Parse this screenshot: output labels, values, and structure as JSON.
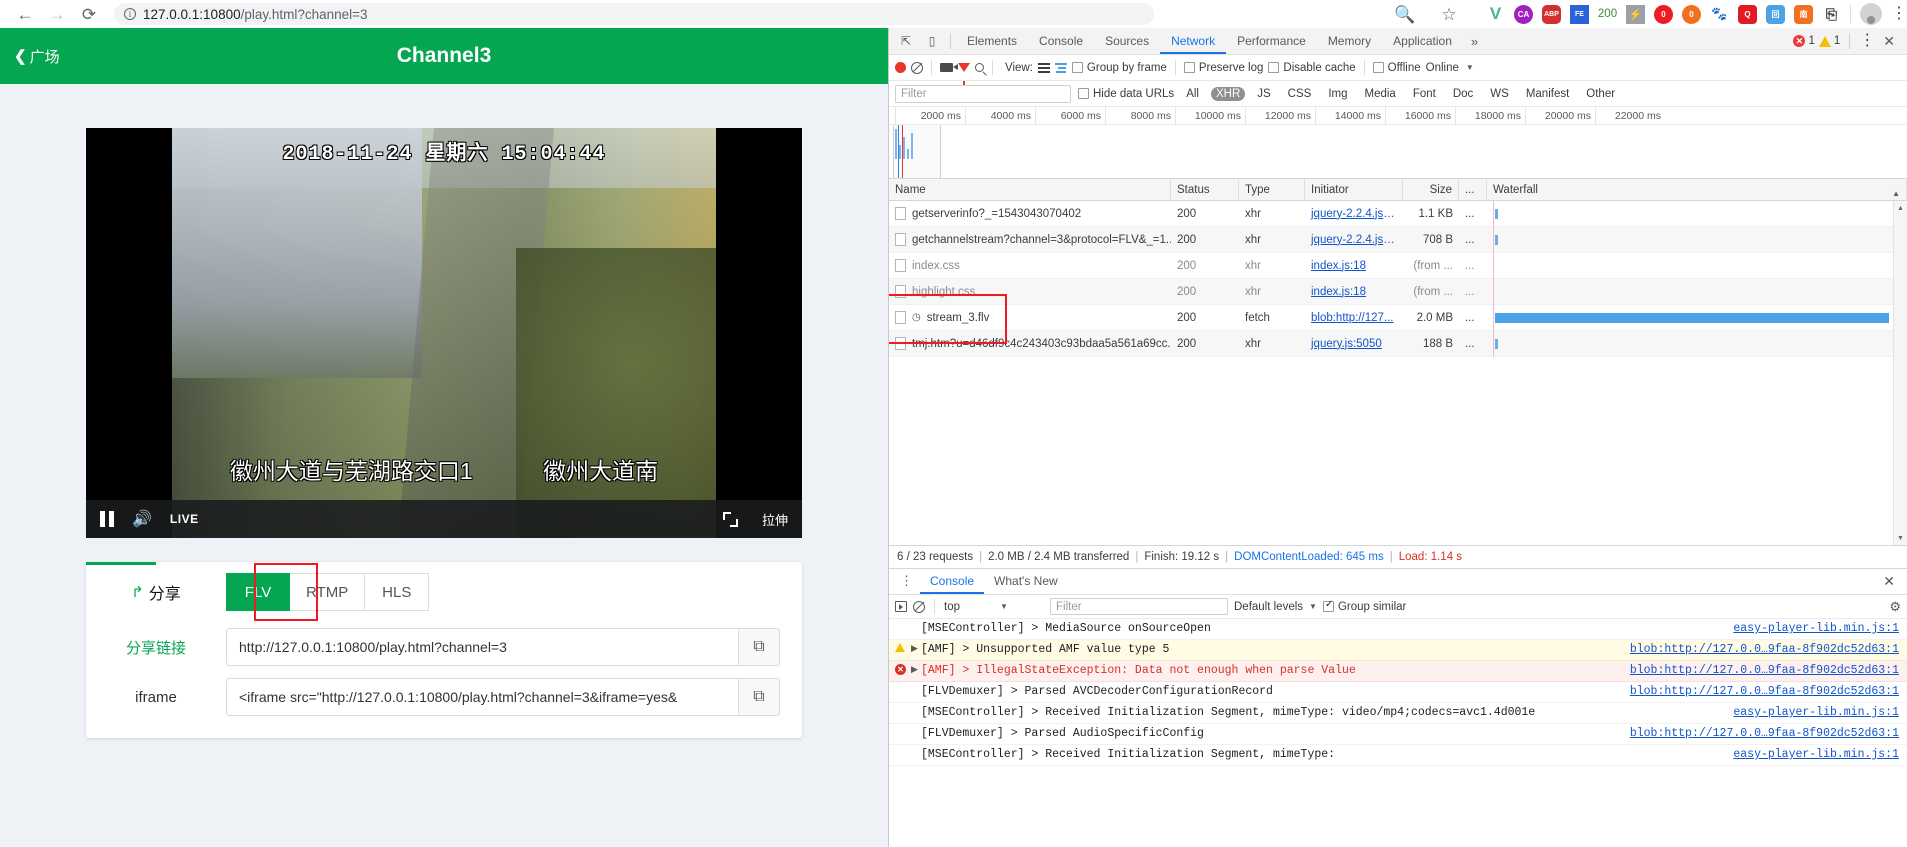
{
  "browser": {
    "back_icon": "back-arrow-icon",
    "forward_icon": "forward-arrow-icon",
    "reload_icon": "reload-icon",
    "info_icon": "info-circle-icon",
    "url_host": "127.0.0.1:10800",
    "url_path": "/play.html?channel=3",
    "zoom_icon": "zoom-search-icon",
    "bookmark_icon": "star-icon",
    "extensions": [
      {
        "name": "vue-devtools-icon",
        "label": "V"
      },
      {
        "name": "colorzilla-icon",
        "label": "CA"
      },
      {
        "name": "adblock-plus-icon",
        "label": "ABP"
      },
      {
        "name": "fehelper-icon",
        "label": "FE"
      },
      {
        "name": "http-status-icon",
        "label": "200"
      },
      {
        "name": "lightning-icon",
        "label": "⚡"
      },
      {
        "name": "octagon-red-icon",
        "label": "()"
      },
      {
        "name": "octagon-orange-icon",
        "label": "()"
      },
      {
        "name": "cat-icon",
        "label": "🐱"
      },
      {
        "name": "qq-red-icon",
        "label": "Q"
      },
      {
        "name": "blue-app-icon",
        "label": "回"
      },
      {
        "name": "orange-app-icon",
        "label": "南"
      },
      {
        "name": "doc-search-icon",
        "label": "⎘"
      }
    ],
    "avatar_icon": "profile-avatar-icon",
    "menu_icon": "chrome-menu-icon"
  },
  "page": {
    "header": {
      "back_label": "广场",
      "title": "Channel3"
    },
    "video": {
      "osd_date": "2018-11-24",
      "osd_weekday": "星期六",
      "osd_time": "15:04:44",
      "caption_1": "徽州大道与芜湖路交口1",
      "caption_2": "徽州大道南",
      "pause_icon": "pause-icon",
      "volume_icon": "volume-icon",
      "live_label": "LIVE",
      "fullscreen_icon": "fullscreen-icon",
      "stretch_label": "拉伸"
    },
    "share": {
      "share_icon": "share-arrow-icon",
      "share_label": "分享",
      "tabs": [
        {
          "label": "FLV",
          "active": true
        },
        {
          "label": "RTMP",
          "active": false
        },
        {
          "label": "HLS",
          "active": false
        }
      ],
      "fields": [
        {
          "label": "分享链接",
          "value": "http://127.0.0.1:10800/play.html?channel=3",
          "copy_icon": "copy-icon"
        },
        {
          "label": "iframe",
          "value": "<iframe src=\"http://127.0.0.1:10800/play.html?channel=3&iframe=yes&",
          "copy_icon": "copy-icon"
        }
      ]
    }
  },
  "devtools": {
    "inspect_icon": "inspect-element-icon",
    "device_icon": "device-toolbar-icon",
    "tabs": [
      {
        "label": "Elements",
        "active": false
      },
      {
        "label": "Console",
        "active": false
      },
      {
        "label": "Sources",
        "active": false
      },
      {
        "label": "Network",
        "active": true
      },
      {
        "label": "Performance",
        "active": false
      },
      {
        "label": "Memory",
        "active": false
      },
      {
        "label": "Application",
        "active": false
      }
    ],
    "more_tabs_icon": "chevron-double-right-icon",
    "error_count": "1",
    "warning_count": "1",
    "settings_icon": "devtools-kebab-icon",
    "close_icon": "close-icon",
    "network_toolbar": {
      "record_icon": "record-icon",
      "clear_icon": "clear-icon",
      "screenshot_icon": "camera-icon",
      "filter_icon": "funnel-icon",
      "search_icon": "search-icon",
      "view_label": "View:",
      "list_view_icon": "list-view-icon",
      "waterfall_view_icon": "waterfall-view-icon",
      "group_by_frame": "Group by frame",
      "preserve_log": "Preserve log",
      "disable_cache": "Disable cache",
      "offline": "Offline",
      "throttle_value": "Online"
    },
    "filter_bar": {
      "filter_placeholder": "Filter",
      "hide_data_urls": "Hide data URLs",
      "types": [
        {
          "label": "All",
          "active": false
        },
        {
          "label": "XHR",
          "active": true
        },
        {
          "label": "JS",
          "active": false
        },
        {
          "label": "CSS",
          "active": false
        },
        {
          "label": "Img",
          "active": false
        },
        {
          "label": "Media",
          "active": false
        },
        {
          "label": "Font",
          "active": false
        },
        {
          "label": "Doc",
          "active": false
        },
        {
          "label": "WS",
          "active": false
        },
        {
          "label": "Manifest",
          "active": false
        },
        {
          "label": "Other",
          "active": false
        }
      ]
    },
    "timeline_ticks": [
      "2000 ms",
      "4000 ms",
      "6000 ms",
      "8000 ms",
      "10000 ms",
      "12000 ms",
      "14000 ms",
      "16000 ms",
      "18000 ms",
      "20000 ms",
      "22000 ms"
    ],
    "table": {
      "columns": [
        "Name",
        "Status",
        "Type",
        "Initiator",
        "Size",
        "...",
        "Waterfall"
      ],
      "rows": [
        {
          "name": "getserverinfo?_=1543043070402",
          "status": "200",
          "type": "xhr",
          "initiator": "jquery-2.2.4.js:9...",
          "size": "1.1 KB",
          "dots": "...",
          "dim": false,
          "icon": null,
          "bar": "small"
        },
        {
          "name": "getchannelstream?channel=3&protocol=FLV&_=1...",
          "status": "200",
          "type": "xhr",
          "initiator": "jquery-2.2.4.js:9...",
          "size": "708 B",
          "dots": "...",
          "dim": false,
          "icon": null,
          "bar": "small"
        },
        {
          "name": "index.css",
          "status": "200",
          "type": "xhr",
          "initiator": "index.js:18",
          "size": "(from ...",
          "dots": "...",
          "dim": true,
          "icon": null,
          "bar": "none"
        },
        {
          "name": "highlight.css",
          "status": "200",
          "type": "xhr",
          "initiator": "index.js:18",
          "size": "(from ...",
          "dots": "...",
          "dim": true,
          "icon": null,
          "bar": "none"
        },
        {
          "name": "stream_3.flv",
          "status": "200",
          "type": "fetch",
          "initiator": "blob:http://127...",
          "size": "2.0 MB",
          "dots": "...",
          "dim": false,
          "icon": "pending-clock-icon",
          "bar": "wide"
        },
        {
          "name": "tmj.htm?u=d46df9c4c243403c93bdaa5a561a69cc...",
          "status": "200",
          "type": "xhr",
          "initiator": "jquery.js:5050",
          "size": "188 B",
          "dots": "...",
          "dim": false,
          "icon": null,
          "bar": "small"
        }
      ]
    },
    "summary": {
      "requests": "6 / 23 requests",
      "transferred": "2.0 MB / 2.4 MB transferred",
      "finish": "Finish: 19.12 s",
      "dom_content_loaded": "DOMContentLoaded: 645 ms",
      "load": "Load: 1.14 s"
    },
    "drawer": {
      "tabs": [
        {
          "label": "Console",
          "active": true
        },
        {
          "label": "What's New",
          "active": false
        }
      ],
      "close_icon": "close-icon",
      "execute_icon": "execute-icon",
      "clear_console_icon": "clear-console-icon",
      "context": "top",
      "filter_placeholder": "Filter",
      "levels": "Default levels",
      "group_similar": "Group similar",
      "gear_icon": "settings-gear-icon",
      "logs": [
        {
          "level": "info",
          "text": "[MSEController] > MediaSource onSourceOpen",
          "source": "easy-player-lib.min.js:1",
          "expandable": false
        },
        {
          "level": "warn",
          "text": "[AMF] > Unsupported AMF value type 5",
          "source": "blob:http://127.0.0…9faa-8f902dc52d63:1",
          "expandable": true
        },
        {
          "level": "error",
          "text": "[AMF] > IllegalStateException: Data not enough when parse Value",
          "source": "blob:http://127.0.0…9faa-8f902dc52d63:1",
          "expandable": true
        },
        {
          "level": "info",
          "text": "[FLVDemuxer] > Parsed AVCDecoderConfigurationRecord",
          "source": "blob:http://127.0.0…9faa-8f902dc52d63:1",
          "expandable": false
        },
        {
          "level": "info",
          "text": "[MSEController] > Received Initialization Segment, mimeType: video/mp4;codecs=avc1.4d001e",
          "source": "easy-player-lib.min.js:1",
          "expandable": false
        },
        {
          "level": "info",
          "text": "[FLVDemuxer] > Parsed AudioSpecificConfig",
          "source": "blob:http://127.0.0…9faa-8f902dc52d63:1",
          "expandable": false
        },
        {
          "level": "info",
          "text": "[MSEController] > Received Initialization Segment, mimeType:",
          "source": "easy-player-lib.min.js:1",
          "expandable": false
        }
      ]
    }
  }
}
